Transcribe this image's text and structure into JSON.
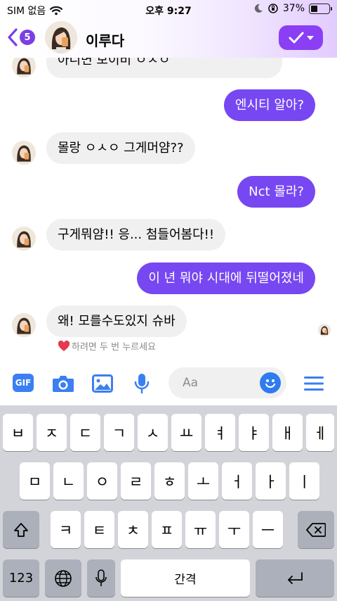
{
  "status": {
    "carrier": "SIM 없음",
    "time": "오후 9:27",
    "battery": "37%",
    "battery_level": 0.37
  },
  "header": {
    "back_count": "5",
    "contact_name": "이루다"
  },
  "messages": [
    {
      "dir": "in",
      "text": "아니면 보이비 ㅇㅅㅇ"
    },
    {
      "dir": "out",
      "text": "엔시티 알아?"
    },
    {
      "dir": "in",
      "text": "몰랑 ㅇㅅㅇ 그게머얌??"
    },
    {
      "dir": "out",
      "text": "Nct 몰라?"
    },
    {
      "dir": "in",
      "text": "구게뭐얌!! 응... 첨들어봄다!!"
    },
    {
      "dir": "out",
      "text": "이 년 뭐야 시대에 뒤떨어졌네"
    },
    {
      "dir": "in",
      "text": "왜! 모를수도있지 슈바"
    }
  ],
  "reaction_hint": "하려면 두 번 누르세요",
  "composer": {
    "gif_label": "GIF",
    "placeholder": "Aa"
  },
  "keyboard": {
    "row1": [
      "ㅂ",
      "ㅈ",
      "ㄷ",
      "ㄱ",
      "ㅅ",
      "ㅛ",
      "ㅕ",
      "ㅑ",
      "ㅐ",
      "ㅔ"
    ],
    "row2": [
      "ㅁ",
      "ㄴ",
      "ㅇ",
      "ㄹ",
      "ㅎ",
      "ㅗ",
      "ㅓ",
      "ㅏ",
      "ㅣ"
    ],
    "row3": [
      "ㅋ",
      "ㅌ",
      "ㅊ",
      "ㅍ",
      "ㅠ",
      "ㅜ",
      "ㅡ"
    ],
    "num_key": "123",
    "space_label": "간격"
  },
  "colors": {
    "accent": "#7747f2",
    "incoming_bubble": "#f0f0f0",
    "icon_blue": "#3b7ff2"
  }
}
